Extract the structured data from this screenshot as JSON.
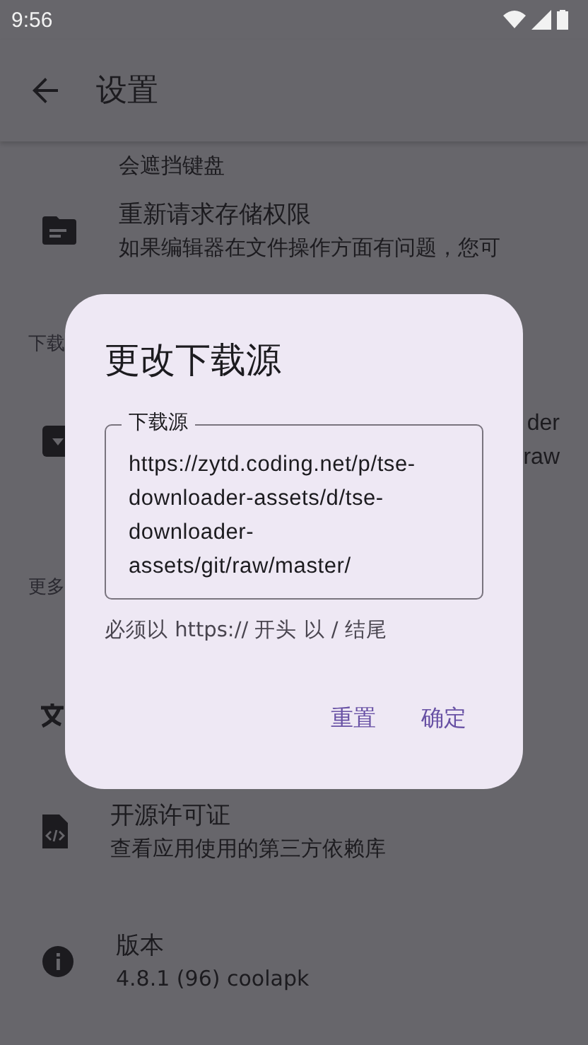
{
  "status_bar": {
    "time": "9:56"
  },
  "app_bar": {
    "title": "设置"
  },
  "background_list": {
    "cut_summary": "会遮挡键盘",
    "items": [
      {
        "kind": "storage",
        "title": "重新请求存储权限",
        "summary": "如果编辑器在文件操作方面有问题，您可"
      }
    ],
    "download_header": "下载",
    "download_item_fragments": [
      "der",
      "raw"
    ],
    "more_header": "更多",
    "more_items": [
      {
        "kind": "license",
        "title": "开源许可证",
        "summary": "查看应用使用的第三方依赖库"
      },
      {
        "kind": "version",
        "title": "版本",
        "summary": "4.8.1 (96) coolapk"
      }
    ]
  },
  "dialog": {
    "title": "更改下载源",
    "field": {
      "label": "下载源",
      "value": "https://zytd.coding.net/p/tse-downloader-assets/d/tse-downloader-assets/git/raw/master/"
    },
    "helper": "必须以 https:// 开头 以 / 结尾",
    "buttons": [
      "重置",
      "确定"
    ]
  }
}
